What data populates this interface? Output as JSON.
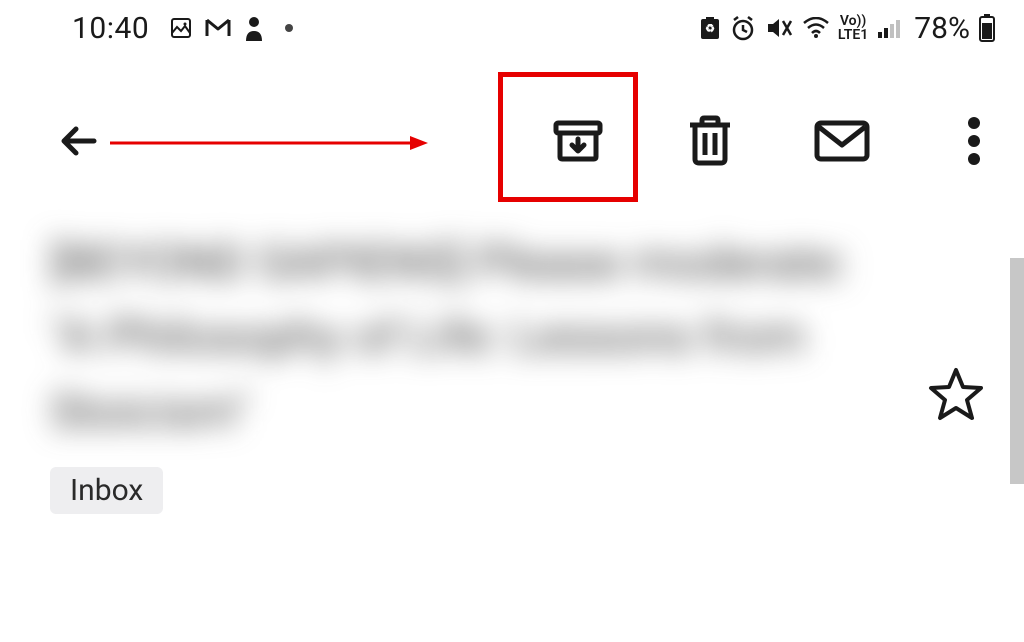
{
  "status_bar": {
    "time": "10:40",
    "battery_percent": "78%",
    "network_label": "Vo))\nLTE1"
  },
  "toolbar": {
    "back": "Back",
    "archive": "Archive",
    "delete": "Delete",
    "mark_unread": "Mark unread",
    "more": "More"
  },
  "email": {
    "subject_blurred": "[BEYOND SAPIENS] Please moderate: \"A Philosophy of Life: Lessons from Stoicism\"",
    "label": "Inbox"
  },
  "annotation": {
    "highlight_target": "archive-button"
  }
}
